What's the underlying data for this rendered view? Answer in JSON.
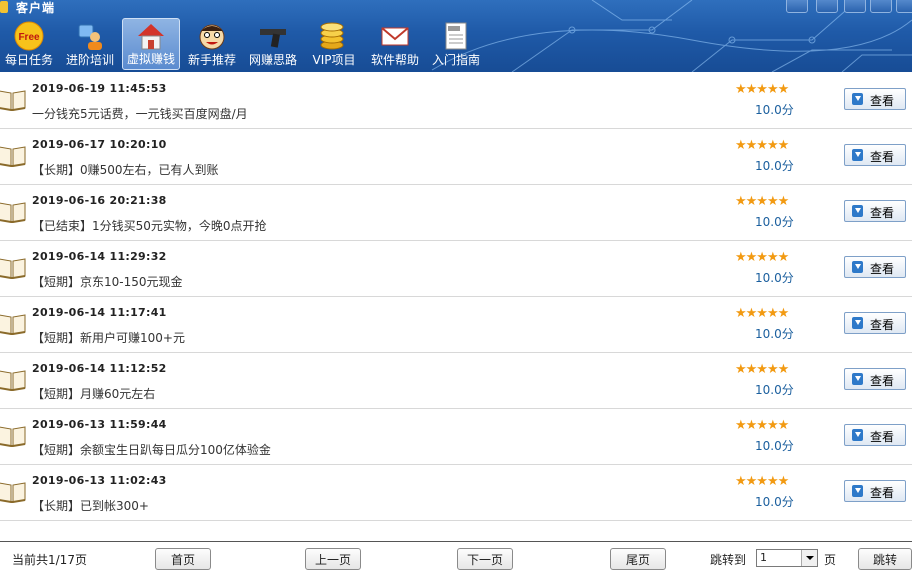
{
  "window": {
    "title": "客户端"
  },
  "toolbar": {
    "items": [
      {
        "label": "每日任务",
        "icon": "free-badge-icon"
      },
      {
        "label": "进阶培训",
        "icon": "users-icon"
      },
      {
        "label": "虚拟赚钱",
        "icon": "house-icon",
        "active": true
      },
      {
        "label": "新手推荐",
        "icon": "face-icon"
      },
      {
        "label": "网赚思路",
        "icon": "pistol-icon"
      },
      {
        "label": "VIP项目",
        "icon": "coins-icon"
      },
      {
        "label": "软件帮助",
        "icon": "envelope-icon"
      },
      {
        "label": "入门指南",
        "icon": "news-doc-icon"
      }
    ]
  },
  "list": {
    "items": [
      {
        "date": "2019-06-19 11:45:53",
        "text": "一分钱充5元话费，一元钱买百度网盘/月",
        "stars": "★★★★★",
        "score": "10.0分",
        "button": "查看"
      },
      {
        "date": "2019-06-17 10:20:10",
        "text": "【长期】0赚500左右，已有人到账",
        "stars": "★★★★★",
        "score": "10.0分",
        "button": "查看"
      },
      {
        "date": "2019-06-16 20:21:38",
        "text": "【已结束】1分钱买50元实物，今晚0点开抢",
        "stars": "★★★★★",
        "score": "10.0分",
        "button": "查看"
      },
      {
        "date": "2019-06-14 11:29:32",
        "text": "【短期】京东10-150元现金",
        "stars": "★★★★★",
        "score": "10.0分",
        "button": "查看"
      },
      {
        "date": "2019-06-14 11:17:41",
        "text": "【短期】新用户可赚100+元",
        "stars": "★★★★★",
        "score": "10.0分",
        "button": "查看"
      },
      {
        "date": "2019-06-14 11:12:52",
        "text": "【短期】月赚60元左右",
        "stars": "★★★★★",
        "score": "10.0分",
        "button": "查看"
      },
      {
        "date": "2019-06-13 11:59:44",
        "text": "【短期】余额宝生日趴每日瓜分100亿体验金",
        "stars": "★★★★★",
        "score": "10.0分",
        "button": "查看"
      },
      {
        "date": "2019-06-13 11:02:43",
        "text": "【长期】已到帐300+",
        "stars": "★★★★★",
        "score": "10.0分",
        "button": "查看"
      }
    ]
  },
  "pager": {
    "info": "当前共1/17页",
    "first": "首页",
    "prev": "上一页",
    "next": "下一页",
    "last": "尾页",
    "jump_label": "跳转到",
    "jump_value": "1",
    "page_unit": "页",
    "jump_button": "跳转"
  },
  "colors": {
    "header": "#1f5aa8",
    "star": "#f29a12",
    "score": "#1b5f9e"
  }
}
